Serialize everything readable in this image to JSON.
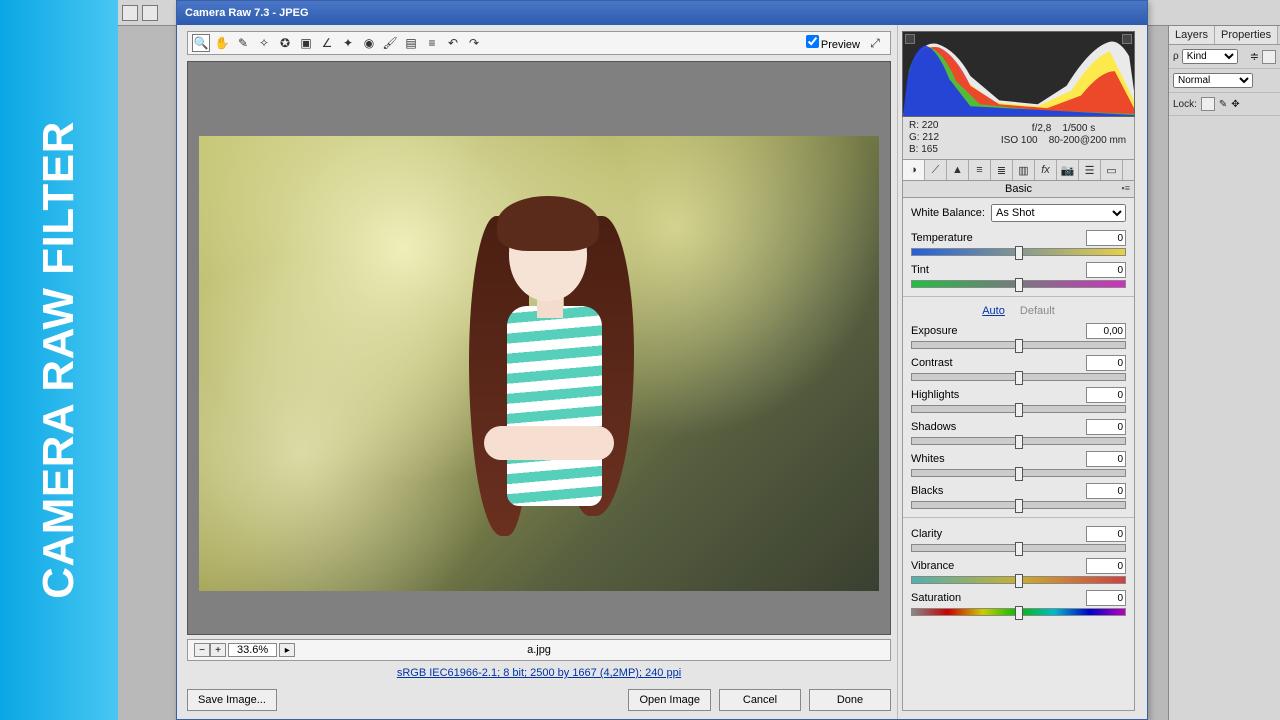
{
  "banner": {
    "text": "CAMERA RAW FILTER"
  },
  "dialog": {
    "title": "Camera Raw 7.3  -  JPEG"
  },
  "toolbar": {
    "preview_label": "Preview",
    "preview_checked": true
  },
  "zoom": {
    "value": "33.6%"
  },
  "filename": "a.jpg",
  "meta_link": "sRGB IEC61966-2.1; 8 bit; 2500 by 1667 (4,2MP); 240 ppi",
  "buttons": {
    "save": "Save Image...",
    "open": "Open Image",
    "cancel": "Cancel",
    "done": "Done"
  },
  "readout": {
    "R": "220",
    "G": "212",
    "B": "165",
    "aperture": "f/2,8",
    "shutter": "1/500 s",
    "iso": "ISO 100",
    "lens": "80-200@200 mm"
  },
  "panel": {
    "name": "Basic",
    "white_balance_label": "White Balance:",
    "white_balance_value": "As Shot",
    "auto": "Auto",
    "default": "Default",
    "sliders": {
      "temperature": {
        "label": "Temperature",
        "value": "0"
      },
      "tint": {
        "label": "Tint",
        "value": "0"
      },
      "exposure": {
        "label": "Exposure",
        "value": "0,00"
      },
      "contrast": {
        "label": "Contrast",
        "value": "0"
      },
      "highlights": {
        "label": "Highlights",
        "value": "0"
      },
      "shadows": {
        "label": "Shadows",
        "value": "0"
      },
      "whites": {
        "label": "Whites",
        "value": "0"
      },
      "blacks": {
        "label": "Blacks",
        "value": "0"
      },
      "clarity": {
        "label": "Clarity",
        "value": "0"
      },
      "vibrance": {
        "label": "Vibrance",
        "value": "0"
      },
      "saturation": {
        "label": "Saturation",
        "value": "0"
      }
    }
  },
  "ps_panels": {
    "tab_layers": "Layers",
    "tab_properties": "Properties",
    "kind": "Kind",
    "blend": "Normal",
    "lock": "Lock:"
  }
}
